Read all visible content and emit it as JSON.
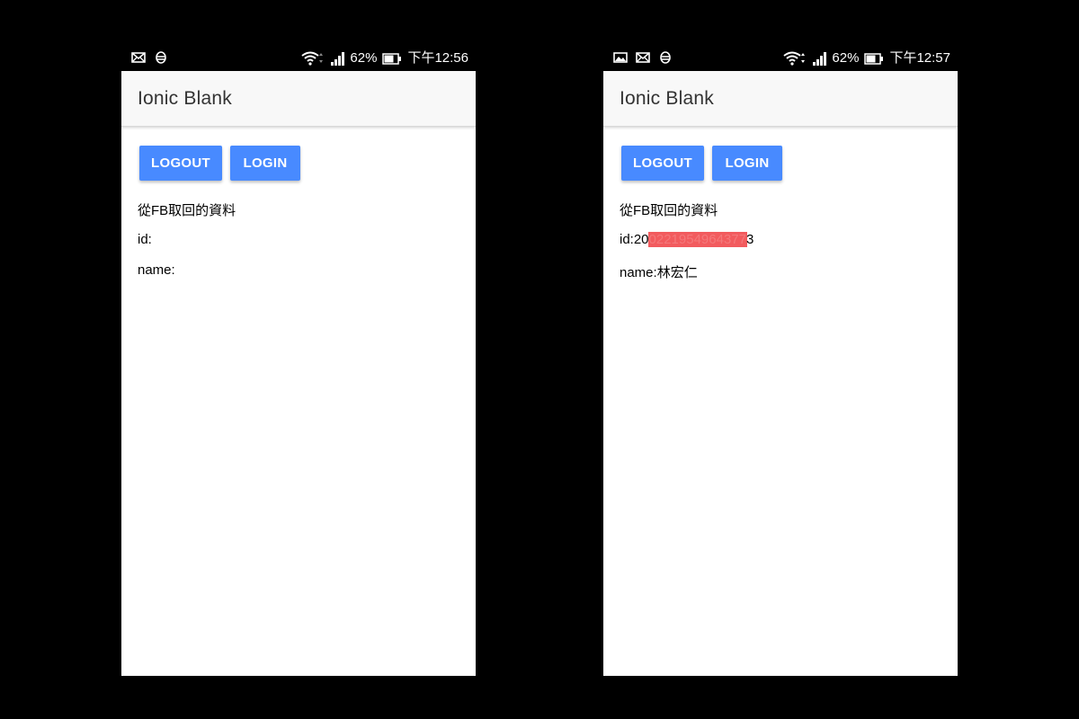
{
  "screens": [
    {
      "status": {
        "battery": "62%",
        "time": "下午12:56",
        "notification_icons": [
          "mail-icon",
          "sync-icon"
        ]
      },
      "title": "Ionic Blank",
      "buttons": {
        "logout": "LOGOUT",
        "login": "LOGIN"
      },
      "heading": "從FB取回的資料",
      "id_label": "id:",
      "id_prefix": "",
      "id_redacted": "",
      "id_suffix": "",
      "name_label": "name:",
      "name_value": ""
    },
    {
      "status": {
        "battery": "62%",
        "time": "下午12:57",
        "notification_icons": [
          "image-icon",
          "mail-icon",
          "sync-icon"
        ]
      },
      "title": "Ionic Blank",
      "buttons": {
        "logout": "LOGOUT",
        "login": "LOGIN"
      },
      "heading": "從FB取回的資料",
      "id_label": "id:",
      "id_prefix": "20",
      "id_redacted": "0221954964377",
      "id_suffix": "3",
      "name_label": "name:",
      "name_value": "林宏仁"
    }
  ],
  "colors": {
    "primary": "#488aff",
    "redaction": "#f25b5e",
    "toolbar": "#f8f8f8"
  }
}
